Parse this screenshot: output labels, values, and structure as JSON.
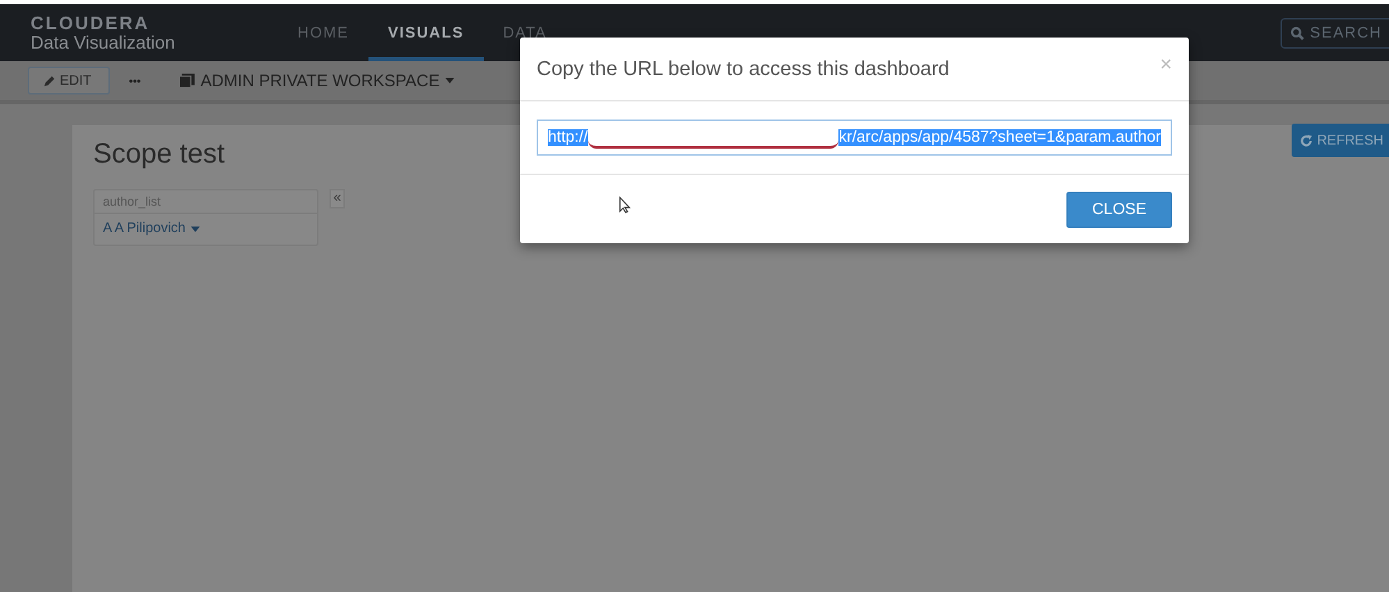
{
  "brand": {
    "name": "CLOUDERA",
    "product": "Data Visualization"
  },
  "nav_tabs": [
    {
      "label": "HOME",
      "selected": false
    },
    {
      "label": "VISUALS",
      "selected": true
    },
    {
      "label": "DATA",
      "selected": false
    }
  ],
  "search_button": {
    "label": "SEARCH"
  },
  "toolbar": {
    "edit_button": "EDIT",
    "more_button": "•••",
    "workspace": "ADMIN PRIVATE WORKSPACE"
  },
  "dashboard": {
    "title": "Scope test",
    "refresh_button": "REFRESH",
    "filter": {
      "label": "author_list",
      "value": "A A Pilipovich"
    },
    "collapse_button": "«"
  },
  "modal": {
    "title": "Copy the URL below to access this dashboard",
    "close_icon": "×",
    "url_field": {
      "value_start": "http://",
      "value_end": "kr/arc/apps/app/4587?sheet=1&param.author",
      "selected": true
    },
    "close_button": "CLOSE"
  }
}
